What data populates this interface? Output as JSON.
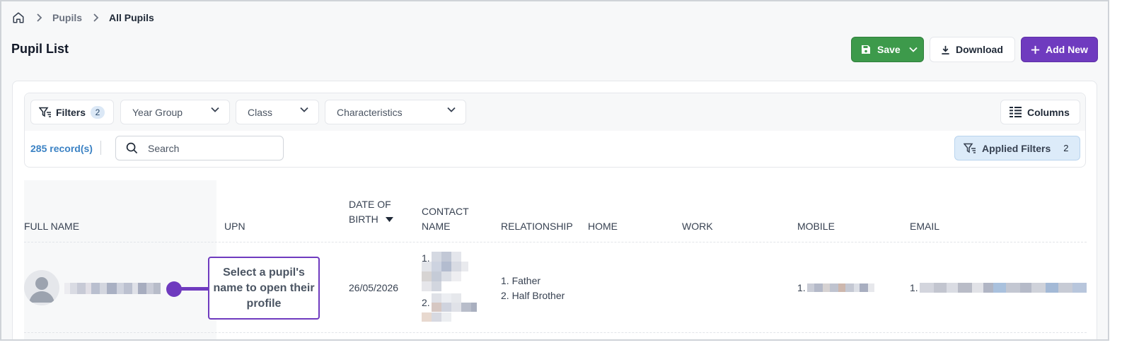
{
  "breadcrumb": {
    "items": [
      "Pupils"
    ],
    "current": "All Pupils"
  },
  "page": {
    "title": "Pupil List"
  },
  "actions": {
    "save": "Save",
    "download": "Download",
    "add_new": "Add New"
  },
  "filters": {
    "label": "Filters",
    "count": "2",
    "year_group": "Year Group",
    "class": "Class",
    "characteristics": "Characteristics",
    "columns": "Columns",
    "records": "285 record(s)",
    "search_placeholder": "Search",
    "applied_label": "Applied Filters",
    "applied_count": "2"
  },
  "table": {
    "headers": {
      "full_name": "FULL NAME",
      "upn": "UPN",
      "dob_line1": "DATE OF",
      "dob_line2": "BIRTH",
      "contact_line1": "CONTACT",
      "contact_line2": "NAME",
      "relationship": "RELATIONSHIP",
      "home": "HOME",
      "work": "WORK",
      "mobile": "MOBILE",
      "email": "EMAIL"
    },
    "rows": [
      {
        "dob": "26/05/2026",
        "contact_index_1": "1.",
        "contact_index_2": "2.",
        "relationship_1": "1. Father",
        "relationship_2": "2. Half Brother",
        "mobile_index": "1.",
        "email_index": "1."
      }
    ]
  },
  "callout": {
    "text": "Select a pupil's name to open their profile"
  },
  "colors": {
    "save": "#3d9a4b",
    "accent": "#6f3bbf",
    "link": "#3b82c4",
    "applied_bg": "#dcebf9"
  },
  "icons": [
    "home-icon",
    "chevron-right-icon",
    "save-icon",
    "chevron-down-icon",
    "download-icon",
    "plus-icon",
    "filter-icon",
    "columns-icon",
    "search-icon",
    "sort-desc-icon",
    "avatar-icon"
  ]
}
